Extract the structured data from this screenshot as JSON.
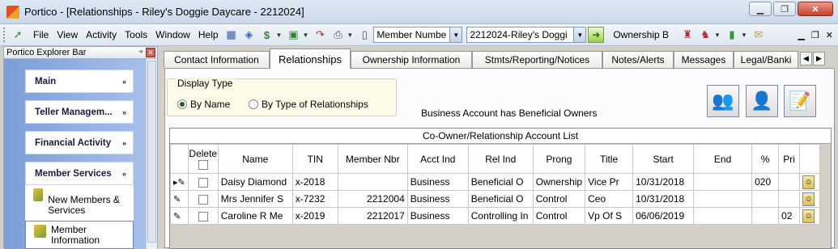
{
  "window": {
    "title": "Portico - [Relationships - Riley's Doggie Daycare - 2212024]"
  },
  "menubar": {
    "items": [
      "File",
      "View",
      "Activity",
      "Tools",
      "Window",
      "Help"
    ],
    "search_field": "Member Numbe",
    "member_combo": "2212024-Riley's Doggi",
    "ownership_label": "Ownership B"
  },
  "explorer": {
    "title": "Portico Explorer Bar",
    "groups": [
      {
        "label": "Main",
        "chevron": "»"
      },
      {
        "label": "Teller Managem...",
        "chevron": "»"
      },
      {
        "label": "Financial Activity",
        "chevron": "»"
      },
      {
        "label": "Member Services",
        "chevron": "«"
      }
    ],
    "subitems": [
      "New Members & Services",
      "Member Information"
    ]
  },
  "tabs": [
    "Contact Information",
    "Relationships",
    "Ownership Information",
    "Stmts/Reporting/Notices",
    "Notes/Alerts",
    "Messages",
    "Legal/Banki"
  ],
  "display_type": {
    "legend": "Display Type",
    "options": [
      "By Name",
      "By Type of Relationships"
    ],
    "selected": "By Name"
  },
  "status_message": "Business Account has Beneficial Owners",
  "grid": {
    "caption": "Co-Owner/Relationship Account List",
    "headers": {
      "delete": "Delete",
      "name": "Name",
      "tin": "TIN",
      "member_nbr": "Member Nbr",
      "acct_ind": "Acct Ind",
      "rel_ind": "Rel Ind",
      "prong": "Prong",
      "title": "Title",
      "start": "Start",
      "end": "End",
      "pct": "%",
      "pri": "Pri"
    },
    "rows": [
      {
        "name": "Daisy Diamond",
        "tin": "x-2018",
        "member_nbr": "",
        "acct_ind": "Business",
        "rel_ind": "Beneficial O",
        "prong": "Ownership",
        "title": "Vice Pr",
        "start": "10/31/2018",
        "end": "",
        "pct": "020",
        "pri": ""
      },
      {
        "name": "Mrs Jennifer S",
        "tin": "x-7232",
        "member_nbr": "2212004",
        "acct_ind": "Business",
        "rel_ind": "Beneficial O",
        "prong": "Control",
        "title": "Ceo",
        "start": "10/31/2018",
        "end": "",
        "pct": "",
        "pri": ""
      },
      {
        "name": "Caroline R Me",
        "tin": "x-2019",
        "member_nbr": "2212017",
        "acct_ind": "Business",
        "rel_ind": "Controlling In",
        "prong": "Control",
        "title": "Vp Of S",
        "start": "06/06/2019",
        "end": "",
        "pct": "",
        "pri": "02"
      }
    ]
  }
}
